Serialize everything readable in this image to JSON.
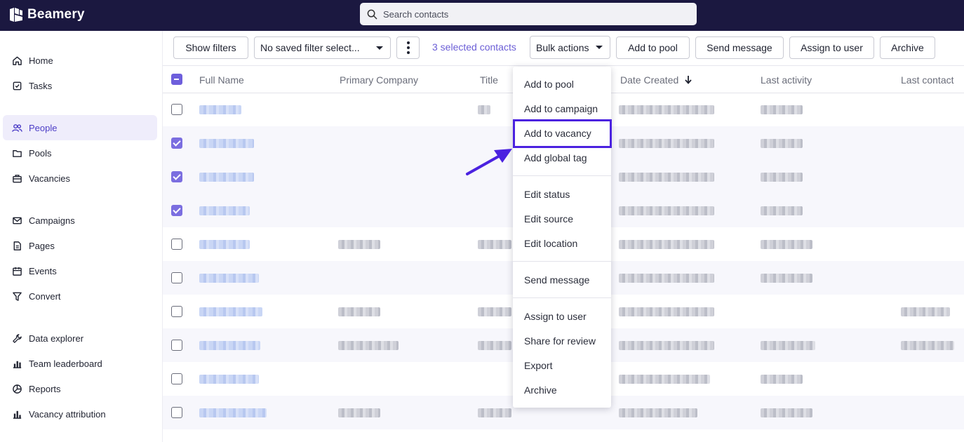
{
  "app": {
    "name": "Beamery",
    "accent": "#6b5ed6",
    "header_bg": "#1b1840"
  },
  "search": {
    "placeholder": "Search contacts"
  },
  "sidebar": {
    "items": [
      {
        "label": "Home",
        "icon": "home-icon"
      },
      {
        "label": "Tasks",
        "icon": "tasks-icon"
      },
      {
        "label": "People",
        "icon": "people-icon",
        "active": true
      },
      {
        "label": "Pools",
        "icon": "folder-icon"
      },
      {
        "label": "Vacancies",
        "icon": "briefcase-icon"
      },
      {
        "label": "Campaigns",
        "icon": "mail-icon"
      },
      {
        "label": "Pages",
        "icon": "page-icon"
      },
      {
        "label": "Events",
        "icon": "calendar-icon"
      },
      {
        "label": "Convert",
        "icon": "funnel-icon"
      },
      {
        "label": "Data explorer",
        "icon": "wrench-icon"
      },
      {
        "label": "Team leaderboard",
        "icon": "bar-chart-icon"
      },
      {
        "label": "Reports",
        "icon": "pie-chart-icon"
      },
      {
        "label": "Vacancy attribution",
        "icon": "bar-chart-icon"
      }
    ]
  },
  "toolbar": {
    "show_filters": "Show filters",
    "saved_filter": "No saved filter select...",
    "selected_count": "3 selected contacts",
    "bulk_actions": "Bulk actions",
    "add_to_pool": "Add to pool",
    "send_message": "Send message",
    "assign_to_user": "Assign to user",
    "archive": "Archive"
  },
  "table": {
    "columns": [
      "Full Name",
      "Primary Company",
      "Title",
      "Date Created",
      "Last activity",
      "Last contact"
    ],
    "sort_icon": "arrow-down-icon",
    "rows": [
      {
        "selected": false
      },
      {
        "selected": true
      },
      {
        "selected": true
      },
      {
        "selected": true
      },
      {
        "selected": false
      },
      {
        "selected": false
      },
      {
        "selected": false
      },
      {
        "selected": false
      },
      {
        "selected": false
      },
      {
        "selected": false
      }
    ]
  },
  "bulk_menu": {
    "groups": [
      [
        "Add to pool",
        "Add to campaign",
        "Add to vacancy",
        "Add global tag"
      ],
      [
        "Edit status",
        "Edit source",
        "Edit location"
      ],
      [
        "Send message"
      ],
      [
        "Assign to user",
        "Share for review",
        "Export",
        "Archive"
      ]
    ],
    "highlighted": "Add to vacancy",
    "highlight_color": "#4b22e0"
  }
}
